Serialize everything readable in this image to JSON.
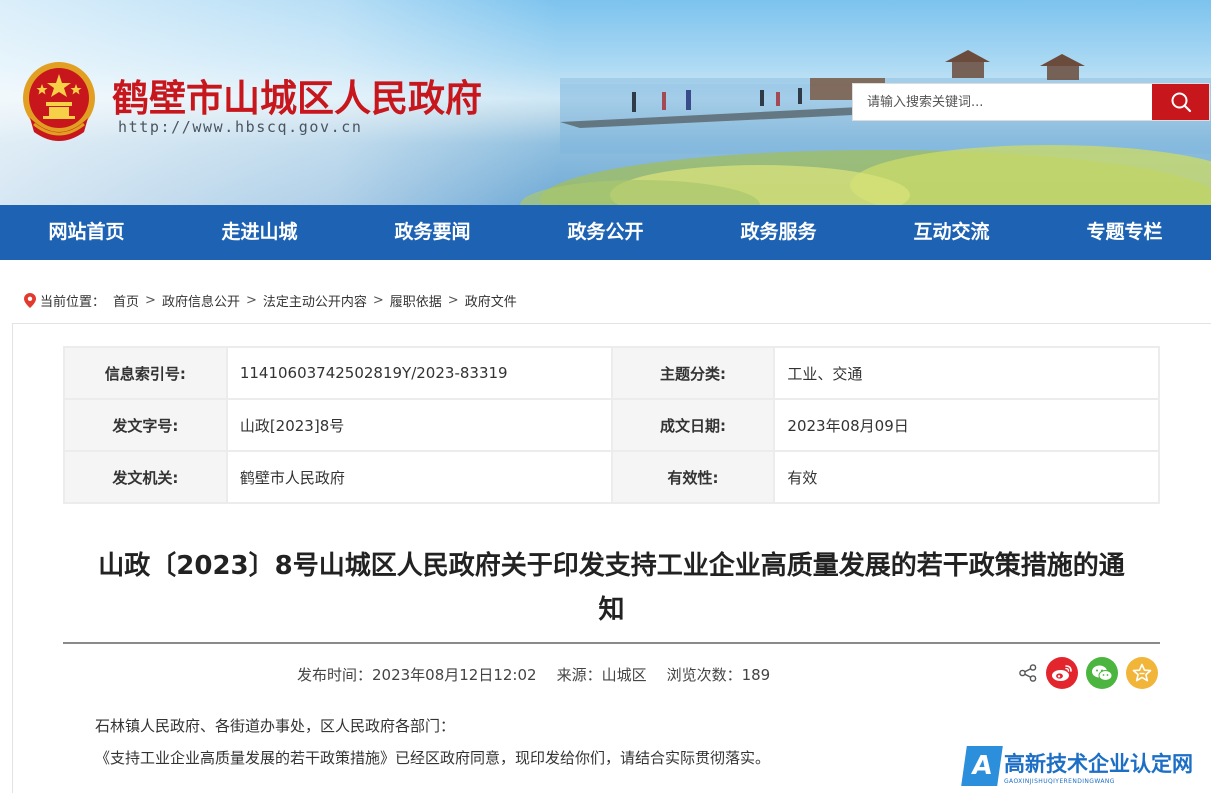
{
  "header": {
    "site_title": "鹤壁市山城区人民政府",
    "site_url": "http://www.hbscq.gov.cn",
    "search_placeholder": "请输入搜索关键词..."
  },
  "nav": {
    "items": [
      "网站首页",
      "走进山城",
      "政务要闻",
      "政务公开",
      "政务服务",
      "互动交流",
      "专题专栏"
    ]
  },
  "breadcrumb": {
    "label": "当前位置：",
    "items": [
      "首页",
      "政府信息公开",
      "法定主动公开内容",
      "履职依据",
      "政府文件"
    ]
  },
  "info": {
    "index_label": "信息索引号:",
    "index_value": "11410603742502819Y/2023-83319",
    "topic_label": "主题分类:",
    "topic_value": "工业、交通",
    "doc_no_label": "发文字号:",
    "doc_no_value": "山政[2023]8号",
    "date_label": "成文日期:",
    "date_value": "2023年08月09日",
    "issuer_label": "发文机关:",
    "issuer_value": "鹤壁市人民政府",
    "validity_label": "有效性:",
    "validity_value": "有效"
  },
  "document": {
    "title_line1": "山政〔2023〕8号山城区人民政府关于印发支持工业企业高质量发展的若干政策措施的通",
    "title_line2": "知",
    "publish_time": "发布时间：2023年08月12日12:02",
    "source": "来源：山城区",
    "views": "浏览次数：189",
    "paragraph1": "石林镇人民政府、各街道办事处，区人民政府各部门：",
    "paragraph2": "《支持工业企业高质量发展的若干政策措施》已经区政府同意，现印发给你们，请结合实际贯彻落实。"
  },
  "share": {
    "icons": [
      "share-icon",
      "weibo-icon",
      "wechat-icon",
      "favorite-icon"
    ]
  },
  "watermark": {
    "mark": "A",
    "text": "高新技术企业认定网",
    "pinyin": "GAOXINJISHUQIYERENDINGWANG"
  },
  "colors": {
    "nav_blue": "#1d62b3",
    "brand_red": "#c8161d",
    "weibo_red": "#e3262e",
    "wechat_green": "#4bb53f",
    "favorite_gold": "#f1b53a"
  }
}
